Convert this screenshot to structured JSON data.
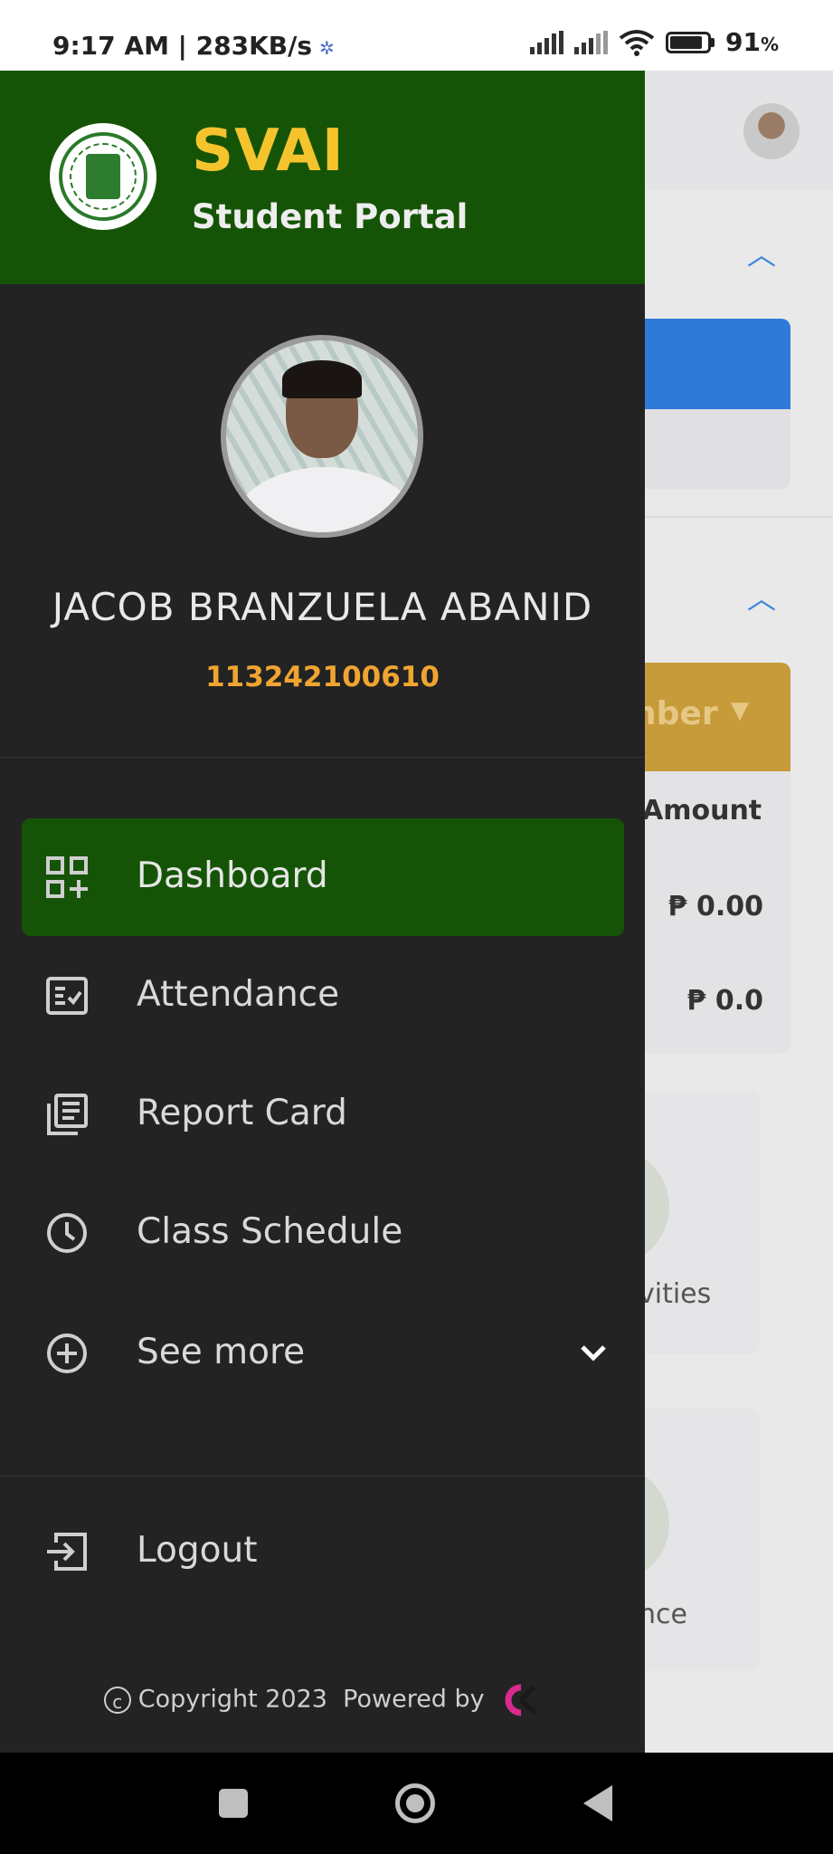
{
  "status_bar": {
    "time_speed": "9:17 AM | 283KB/s",
    "battery_percent": "91",
    "battery_unit": "%"
  },
  "background": {
    "header_fragment": "nber",
    "amount_header": "Amount",
    "amount_row_1": "₱ 0.00",
    "amount_row_2": "₱ 0.0",
    "card_label_1": "vities",
    "card_label_2": "nce"
  },
  "drawer": {
    "brand": "SVAI",
    "subtitle": "Student Portal",
    "student_name": "JACOB BRANZUELA ABANID",
    "student_id": "113242100610",
    "menu": [
      {
        "label": "Dashboard",
        "icon": "dashboard-icon",
        "active": true
      },
      {
        "label": "Attendance",
        "icon": "checklist-icon",
        "active": false
      },
      {
        "label": "Report Card",
        "icon": "report-card-icon",
        "active": false
      },
      {
        "label": "Class Schedule",
        "icon": "clock-icon",
        "active": false
      },
      {
        "label": "See more",
        "icon": "plus-circle-icon",
        "active": false
      }
    ],
    "logout": "Logout",
    "footer": {
      "copyright": "Copyright 2023",
      "powered_by": "Powered by"
    }
  },
  "colors": {
    "header_green": "#155406",
    "brand_yellow": "#f5c42c",
    "id_orange": "#f0a531",
    "drawer_bg": "#232324"
  }
}
